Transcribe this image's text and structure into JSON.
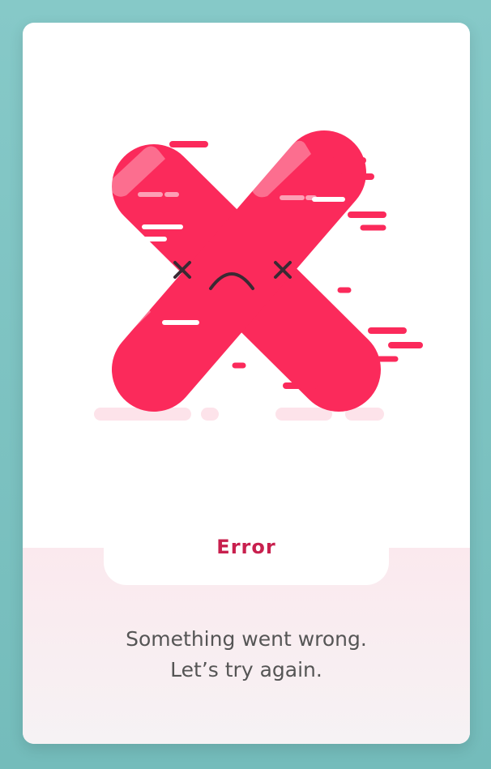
{
  "error_card": {
    "title": "Error",
    "message_line1": "Something went wrong.",
    "message_line2": "Let’s try again.",
    "illustration_icon": "sad-red-x-icon"
  },
  "colors": {
    "background": "#7ec4c4",
    "card": "#ffffff",
    "accent_red": "#fb2a5b",
    "title_text": "#c8204e",
    "body_text": "#555555",
    "panel_pink": "#fbe9ee"
  }
}
